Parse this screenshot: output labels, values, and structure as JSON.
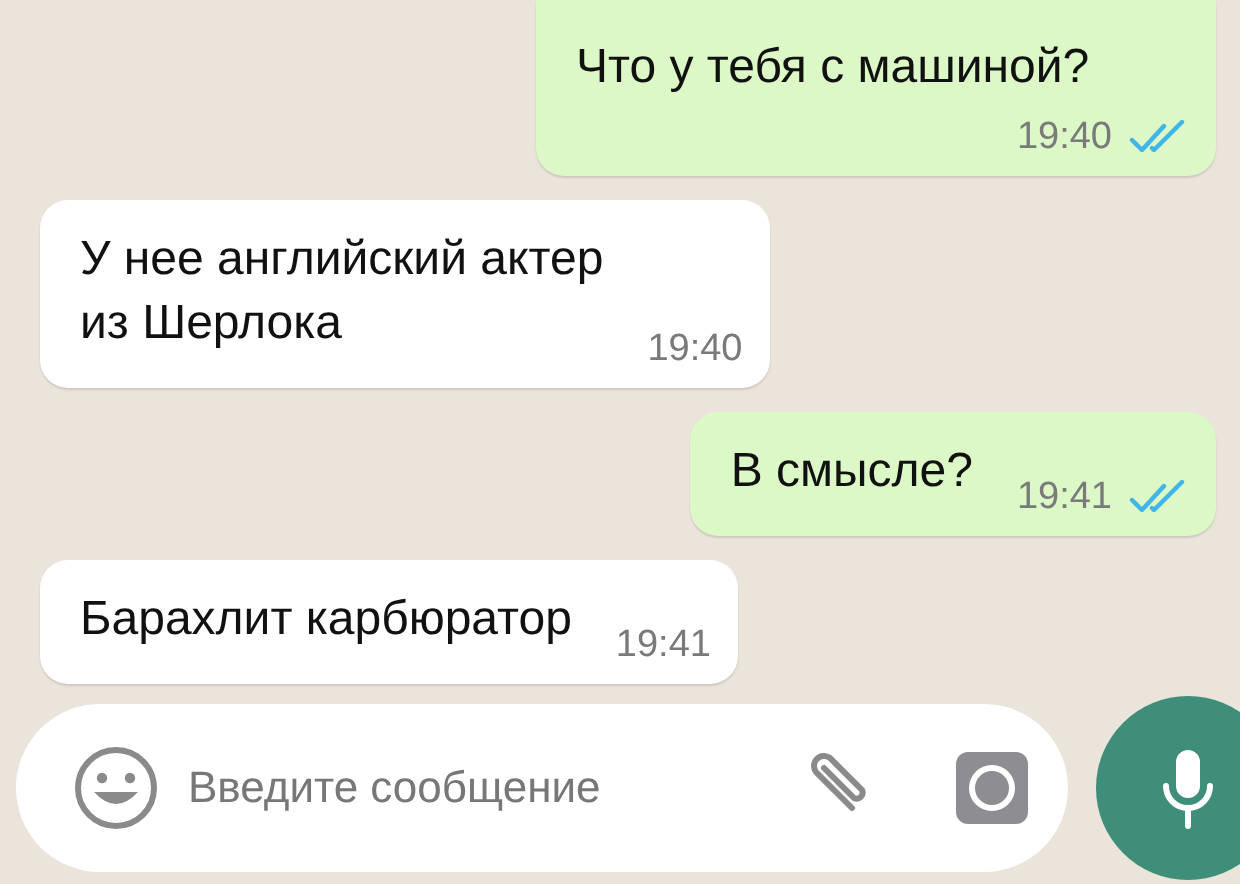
{
  "messages": [
    {
      "kind": "outgoing",
      "text": "Что у тебя с машиной?",
      "time": "19:40",
      "read": true
    },
    {
      "kind": "incoming",
      "text": "У нее английский актер\nиз Шерлока",
      "time": "19:40"
    },
    {
      "kind": "outgoing",
      "text": "В смысле?",
      "time": "19:41",
      "read": true
    },
    {
      "kind": "incoming",
      "text": "Барахлит карбюратор",
      "time": "19:41"
    }
  ],
  "composer": {
    "placeholder": "Введите сообщение"
  }
}
